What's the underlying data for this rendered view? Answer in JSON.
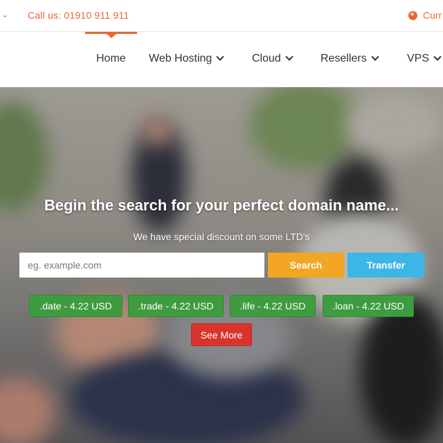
{
  "topbar": {
    "call_label": "Call us: 01910 911 911",
    "currency_label": "Curr"
  },
  "nav": {
    "items": [
      {
        "label": "Home",
        "active": true,
        "dropdown": false
      },
      {
        "label": "Web Hosting",
        "active": false,
        "dropdown": true
      },
      {
        "label": "Cloud",
        "active": false,
        "dropdown": true
      },
      {
        "label": "Resellers",
        "active": false,
        "dropdown": true
      },
      {
        "label": "VPS",
        "active": false,
        "dropdown": true
      }
    ]
  },
  "hero": {
    "title": "Begin the search for your perfect domain name...",
    "subtitle": "We have special discount on some LTD's",
    "search": {
      "placeholder": "eg. example.com",
      "value": ""
    },
    "search_button": "Search",
    "transfer_button": "Transfer",
    "tlds": [
      {
        "label": ".date - 4.22 USD"
      },
      {
        "label": ".trade - 4.22 USD"
      },
      {
        "label": ".life - 4.22 USD"
      },
      {
        "label": ".loan - 4.22 USD"
      }
    ],
    "see_more": "See More"
  },
  "colors": {
    "accent": "#e8672c",
    "search_button": "#f2a623",
    "transfer_button": "#3db6e6",
    "tld_button": "#3f9b3f",
    "see_more_button": "#d9342b"
  },
  "icons": {
    "topbar_left": "chevron-down-icon",
    "currency": "globe-icon",
    "nav_dropdown": "chevron-down-icon"
  }
}
